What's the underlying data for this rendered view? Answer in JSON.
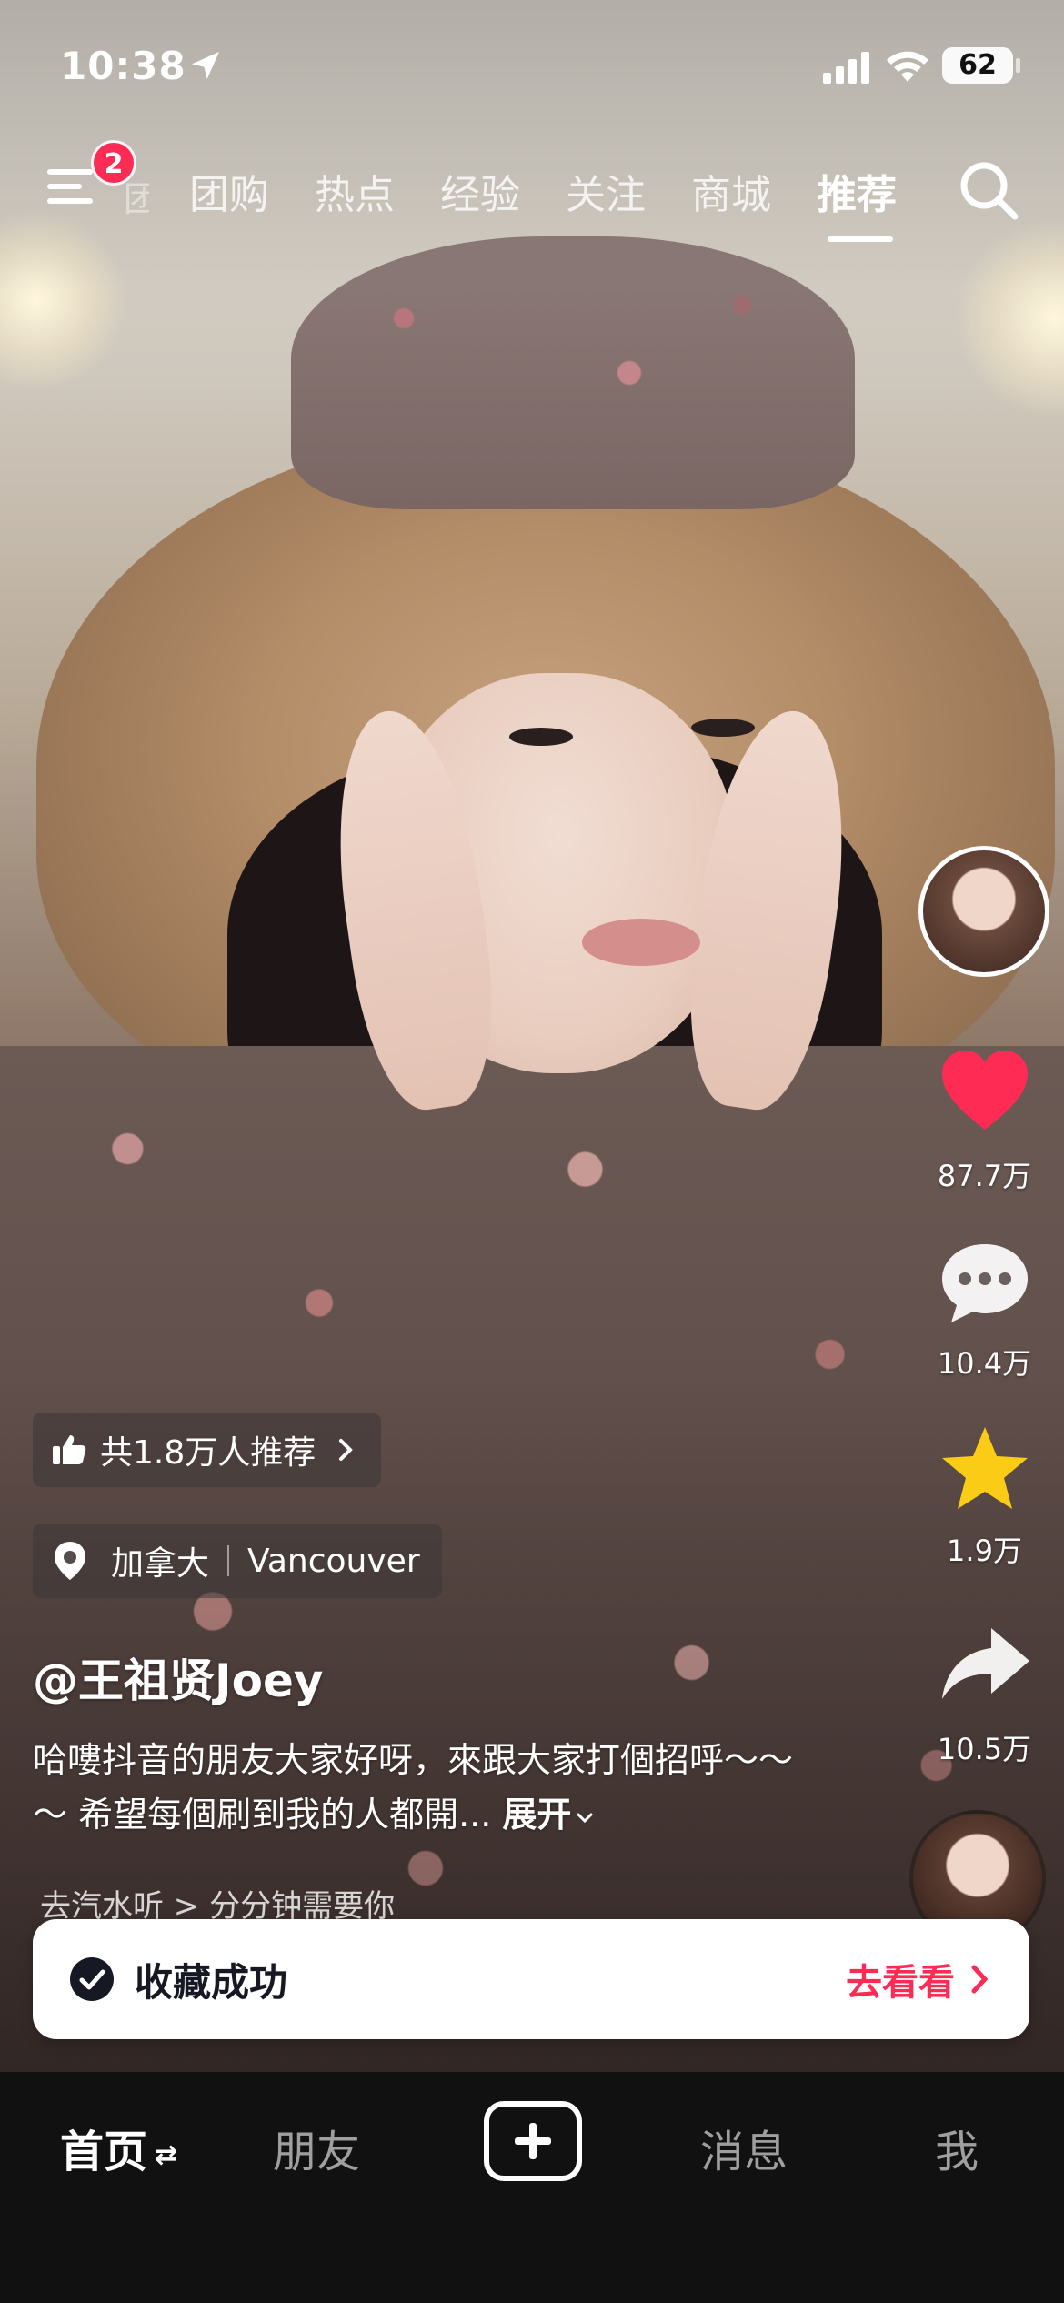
{
  "status_bar": {
    "time": "10:38",
    "battery": "62"
  },
  "top_nav": {
    "menu_badge": "2",
    "partial_tab": "团",
    "tabs": [
      {
        "label": "团购"
      },
      {
        "label": "热点"
      },
      {
        "label": "经验"
      },
      {
        "label": "关注"
      },
      {
        "label": "商城"
      },
      {
        "label": "推荐",
        "active": true
      }
    ]
  },
  "actions": {
    "likes": "87.7万",
    "comments": "10.4万",
    "favorites": "1.9万",
    "shares": "10.5万"
  },
  "video_info": {
    "recommend_chip": "共1.8万人推荐",
    "location_region": "加拿大",
    "location_city": "Vancouver",
    "author": "@王祖贤Joey",
    "description": "哈嘍抖音的朋友大家好呀，來跟大家打個招呼～～～ 希望每個刷到我的人都開...",
    "expand_label": "展开",
    "sub_line": "去汽水听 >  分分钟需要你"
  },
  "toast": {
    "message": "收藏成功",
    "action": "去看看"
  },
  "bottom_tabs": {
    "home": "首页",
    "friends": "朋友",
    "messages": "消息",
    "me": "我"
  },
  "colors": {
    "accent": "#fe2c55",
    "like_heart": "#fe2c55",
    "favorite_star": "#facc15",
    "tab_bar_bg": "#111111"
  },
  "icons": [
    "location-arrow-icon",
    "signal-icon",
    "wifi-icon",
    "menu-icon",
    "search-icon",
    "heart-icon",
    "comment-icon",
    "star-icon",
    "share-icon",
    "thumbs-up-icon",
    "chevron-right-icon",
    "location-pin-icon",
    "check-circle-icon",
    "plus-icon"
  ]
}
